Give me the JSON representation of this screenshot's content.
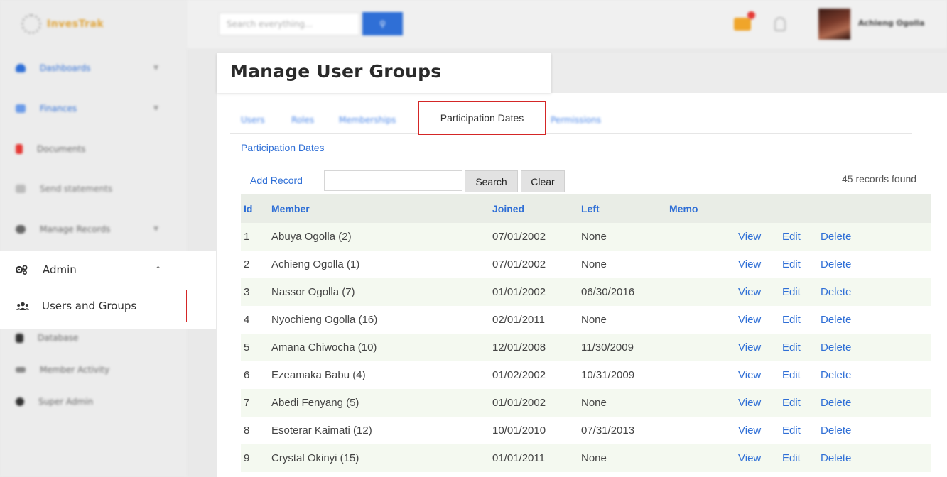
{
  "app": {
    "logo_text": "InvesTrak"
  },
  "topbar": {
    "search_placeholder": "Search everything...",
    "search_button_icon": "search-icon",
    "user_name": "Achieng Ogolla"
  },
  "sidebar": {
    "items": [
      {
        "label": "Dashboards",
        "icon": "cloud-icon",
        "color": "#2f6fd6"
      },
      {
        "label": "Finances",
        "icon": "grid-icon",
        "color": "#2f6fd6"
      },
      {
        "label": "Documents",
        "icon": "file-icon",
        "color": "#e53935"
      },
      {
        "label": "Send statements",
        "icon": "mail-icon",
        "color": "#888888"
      },
      {
        "label": "Manage Records",
        "icon": "database-icon",
        "color": "#555555"
      },
      {
        "label": "Admin",
        "icon": "gears-icon",
        "color": "#333333"
      },
      {
        "label": "Users and Groups",
        "icon": "users-icon",
        "color": "#333333"
      },
      {
        "label": "Database",
        "icon": "db-icon",
        "color": "#333333"
      },
      {
        "label": "Member Activity",
        "icon": "chart-icon",
        "color": "#555555"
      },
      {
        "label": "Super Admin",
        "icon": "globe-icon",
        "color": "#333333"
      }
    ]
  },
  "page": {
    "title": "Manage User Groups",
    "tabs": [
      "Users",
      "Roles",
      "Memberships",
      "Participation Dates",
      "Permissions"
    ],
    "active_tab": "Participation Dates",
    "subtitle": "Participation Dates"
  },
  "toolbar": {
    "add_record": "Add Record",
    "search_label": "Search",
    "clear_label": "Clear",
    "records_found": "45 records found"
  },
  "table": {
    "headers": [
      "Id",
      "Member",
      "Joined",
      "Left",
      "Memo"
    ],
    "actions": [
      "View",
      "Edit",
      "Delete"
    ],
    "rows": [
      {
        "id": "1",
        "member": "Abuya Ogolla (2)",
        "joined": "07/01/2002",
        "left": "None",
        "memo": ""
      },
      {
        "id": "2",
        "member": "Achieng Ogolla (1)",
        "joined": "07/01/2002",
        "left": "None",
        "memo": ""
      },
      {
        "id": "3",
        "member": "Nassor Ogolla (7)",
        "joined": "01/01/2002",
        "left": "06/30/2016",
        "memo": ""
      },
      {
        "id": "4",
        "member": "Nyochieng Ogolla (16)",
        "joined": "02/01/2011",
        "left": "None",
        "memo": ""
      },
      {
        "id": "5",
        "member": "Amana Chiwocha (10)",
        "joined": "12/01/2008",
        "left": "11/30/2009",
        "memo": ""
      },
      {
        "id": "6",
        "member": "Ezeamaka Babu (4)",
        "joined": "01/02/2002",
        "left": "10/31/2009",
        "memo": ""
      },
      {
        "id": "7",
        "member": "Abedi Fenyang (5)",
        "joined": "01/01/2002",
        "left": "None",
        "memo": ""
      },
      {
        "id": "8",
        "member": "Esoterar Kaimati (12)",
        "joined": "10/01/2010",
        "left": "07/31/2013",
        "memo": ""
      },
      {
        "id": "9",
        "member": "Crystal Okinyi (15)",
        "joined": "01/01/2011",
        "left": "None",
        "memo": ""
      }
    ]
  }
}
